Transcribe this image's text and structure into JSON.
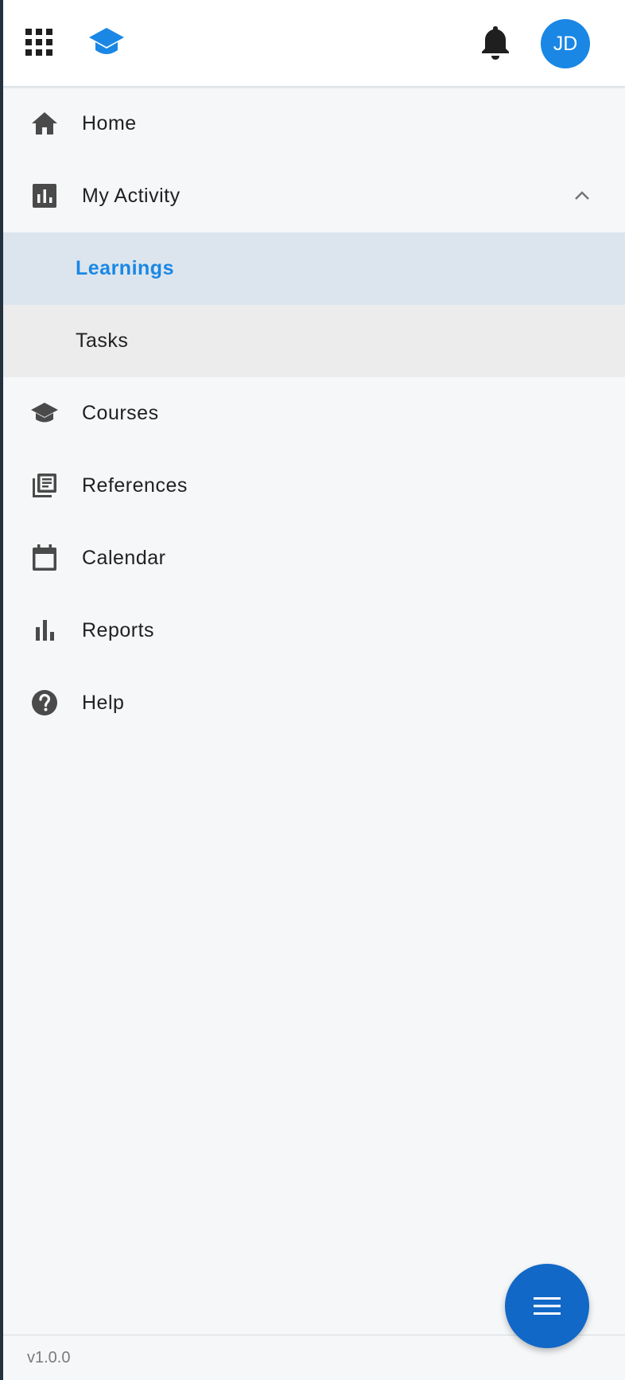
{
  "header": {
    "apps_icon": "apps-grid-icon",
    "logo_icon": "graduation-cap-icon",
    "notifications_icon": "bell-icon",
    "avatar_initials": "JD",
    "accent_color": "#1a87e5"
  },
  "nav": {
    "home": {
      "label": "Home",
      "icon": "home-icon"
    },
    "my_activity": {
      "label": "My Activity",
      "icon": "activity-chart-icon",
      "expanded": true
    },
    "learnings": {
      "label": "Learnings",
      "selected": true
    },
    "tasks": {
      "label": "Tasks"
    },
    "courses": {
      "label": "Courses",
      "icon": "graduation-cap-icon"
    },
    "references": {
      "label": "References",
      "icon": "library-books-icon"
    },
    "calendar": {
      "label": "Calendar",
      "icon": "calendar-icon"
    },
    "reports": {
      "label": "Reports",
      "icon": "bar-chart-icon"
    },
    "help": {
      "label": "Help",
      "icon": "help-circle-icon"
    }
  },
  "footer": {
    "version": "v1.0.0"
  },
  "fab": {
    "icon": "menu-icon",
    "color": "#1268c7"
  }
}
